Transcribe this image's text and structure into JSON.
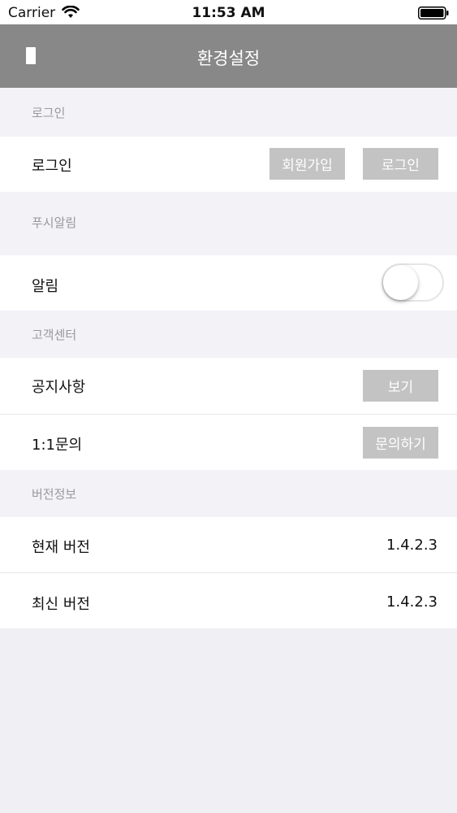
{
  "status_bar": {
    "carrier": "Carrier",
    "time": "11:53 AM"
  },
  "nav": {
    "title": "환경설정"
  },
  "sections": {
    "login": {
      "header": "로그인",
      "row_label": "로그인",
      "signup_button": "회원가입",
      "login_button": "로그인"
    },
    "push": {
      "header": "푸시알림",
      "row_label": "알림",
      "toggle_on": false
    },
    "support": {
      "header": "고객센터",
      "notice_label": "공지사항",
      "notice_button": "보기",
      "inquiry_label": "1:1문의",
      "inquiry_button": "문의하기"
    },
    "version": {
      "header": "버전정보",
      "current_label": "현재 버전",
      "current_value": "1.4.2.3",
      "latest_label": "최신 버전",
      "latest_value": "1.4.2.3"
    }
  },
  "colors": {
    "nav_bg": "#888888",
    "button_bg": "#c3c3c3",
    "section_bg": "#f2f2f7",
    "page_bg": "#efeff4"
  }
}
